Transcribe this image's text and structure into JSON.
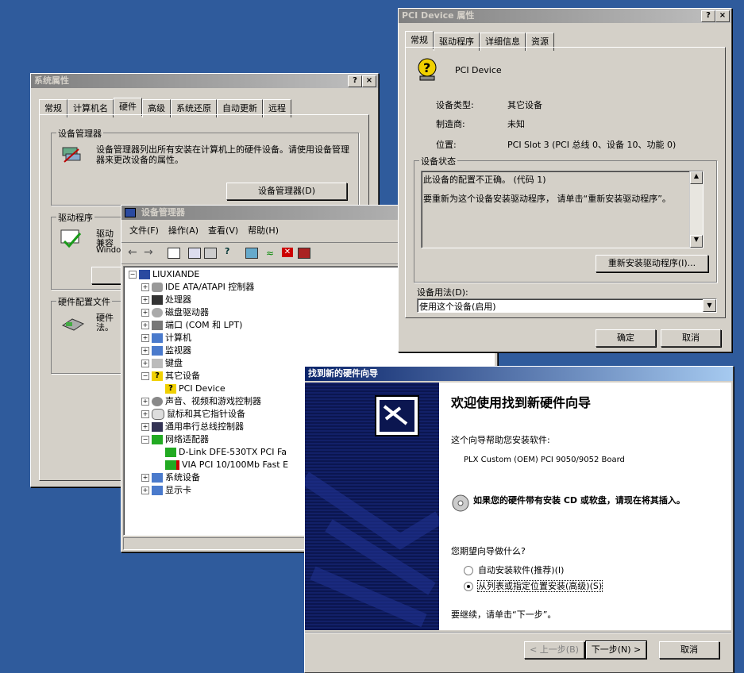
{
  "sys_props": {
    "title": "系统属性",
    "tabs": [
      "常规",
      "计算机名",
      "硬件",
      "高级",
      "系统还原",
      "自动更新",
      "远程"
    ],
    "device_manager_group": "设备管理器",
    "device_manager_desc": "设备管理器列出所有安装在计算机上的硬件设备。请使用设备管理器来更改设备的属性。",
    "device_manager_button": "设备管理器(D)",
    "drivers_group": "驱动程序",
    "drivers_desc_1": "驱动",
    "drivers_desc_2": "兼容",
    "drivers_desc_3": "Windo",
    "hw_profiles_group": "硬件配置文件",
    "hw_profiles_desc_1": "硬件",
    "hw_profiles_desc_2": "法。"
  },
  "devmgr": {
    "title": "设备管理器",
    "menu": [
      "文件(F)",
      "操作(A)",
      "查看(V)",
      "帮助(H)"
    ],
    "tree": [
      {
        "label": "LIUXIANDE",
        "level": 0,
        "expander": "-"
      },
      {
        "label": "IDE ATA/ATAPI 控制器",
        "level": 1,
        "expander": "+"
      },
      {
        "label": "处理器",
        "level": 1,
        "expander": "+"
      },
      {
        "label": "磁盘驱动器",
        "level": 1,
        "expander": "+"
      },
      {
        "label": "端口 (COM 和 LPT)",
        "level": 1,
        "expander": "+"
      },
      {
        "label": "计算机",
        "level": 1,
        "expander": "+"
      },
      {
        "label": "监视器",
        "level": 1,
        "expander": "+"
      },
      {
        "label": "键盘",
        "level": 1,
        "expander": "+"
      },
      {
        "label": "其它设备",
        "level": 1,
        "expander": "-"
      },
      {
        "label": "PCI Device",
        "level": 2,
        "expander": ""
      },
      {
        "label": "声音、视频和游戏控制器",
        "level": 1,
        "expander": "+"
      },
      {
        "label": "鼠标和其它指针设备",
        "level": 1,
        "expander": "+"
      },
      {
        "label": "通用串行总线控制器",
        "level": 1,
        "expander": "+"
      },
      {
        "label": "网络适配器",
        "level": 1,
        "expander": "-"
      },
      {
        "label": "D-Link DFE-530TX PCI Fa",
        "level": 2,
        "expander": ""
      },
      {
        "label": "VIA PCI 10/100Mb Fast E",
        "level": 2,
        "expander": ""
      },
      {
        "label": "系统设备",
        "level": 1,
        "expander": "+"
      },
      {
        "label": "显示卡",
        "level": 1,
        "expander": "+"
      }
    ]
  },
  "pci_props": {
    "title": "PCI Device 属性",
    "tabs": [
      "常规",
      "驱动程序",
      "详细信息",
      "资源"
    ],
    "device_name": "PCI Device",
    "type_label": "设备类型:",
    "type_value": "其它设备",
    "mfr_label": "制造商:",
    "mfr_value": "未知",
    "loc_label": "位置:",
    "loc_value": "PCI Slot 3 (PCI 总线 0、设备 10、功能 0)",
    "status_group": "设备状态",
    "status_line1": "此设备的配置不正确。 (代码 1)",
    "status_line2": "要重新为这个设备安装驱动程序， 请单击“重新安装驱动程序”。",
    "reinstall_button": "重新安装驱动程序(I)...",
    "usage_label": "设备用法(D):",
    "usage_value": "使用这个设备(启用)",
    "ok_button": "确定",
    "cancel_button": "取消"
  },
  "wizard": {
    "title": "找到新的硬件向导",
    "heading": "欢迎使用找到新硬件向导",
    "intro": "这个向导帮助您安装软件:",
    "device": "PLX Custom (OEM) PCI 9050/9052 Board",
    "cd_hint": "如果您的硬件带有安装 CD 或软盘，请现在将其插入。",
    "question": "您期望向导做什么?",
    "option_auto": "自动安装软件(推荐)(I)",
    "option_list": "从列表或指定位置安装(高级)(S)",
    "continue_hint": "要继续，请单击“下一步”。",
    "back_button": "< 上一步(B)",
    "next_button": "下一步(N) >",
    "cancel_button": "取消"
  }
}
